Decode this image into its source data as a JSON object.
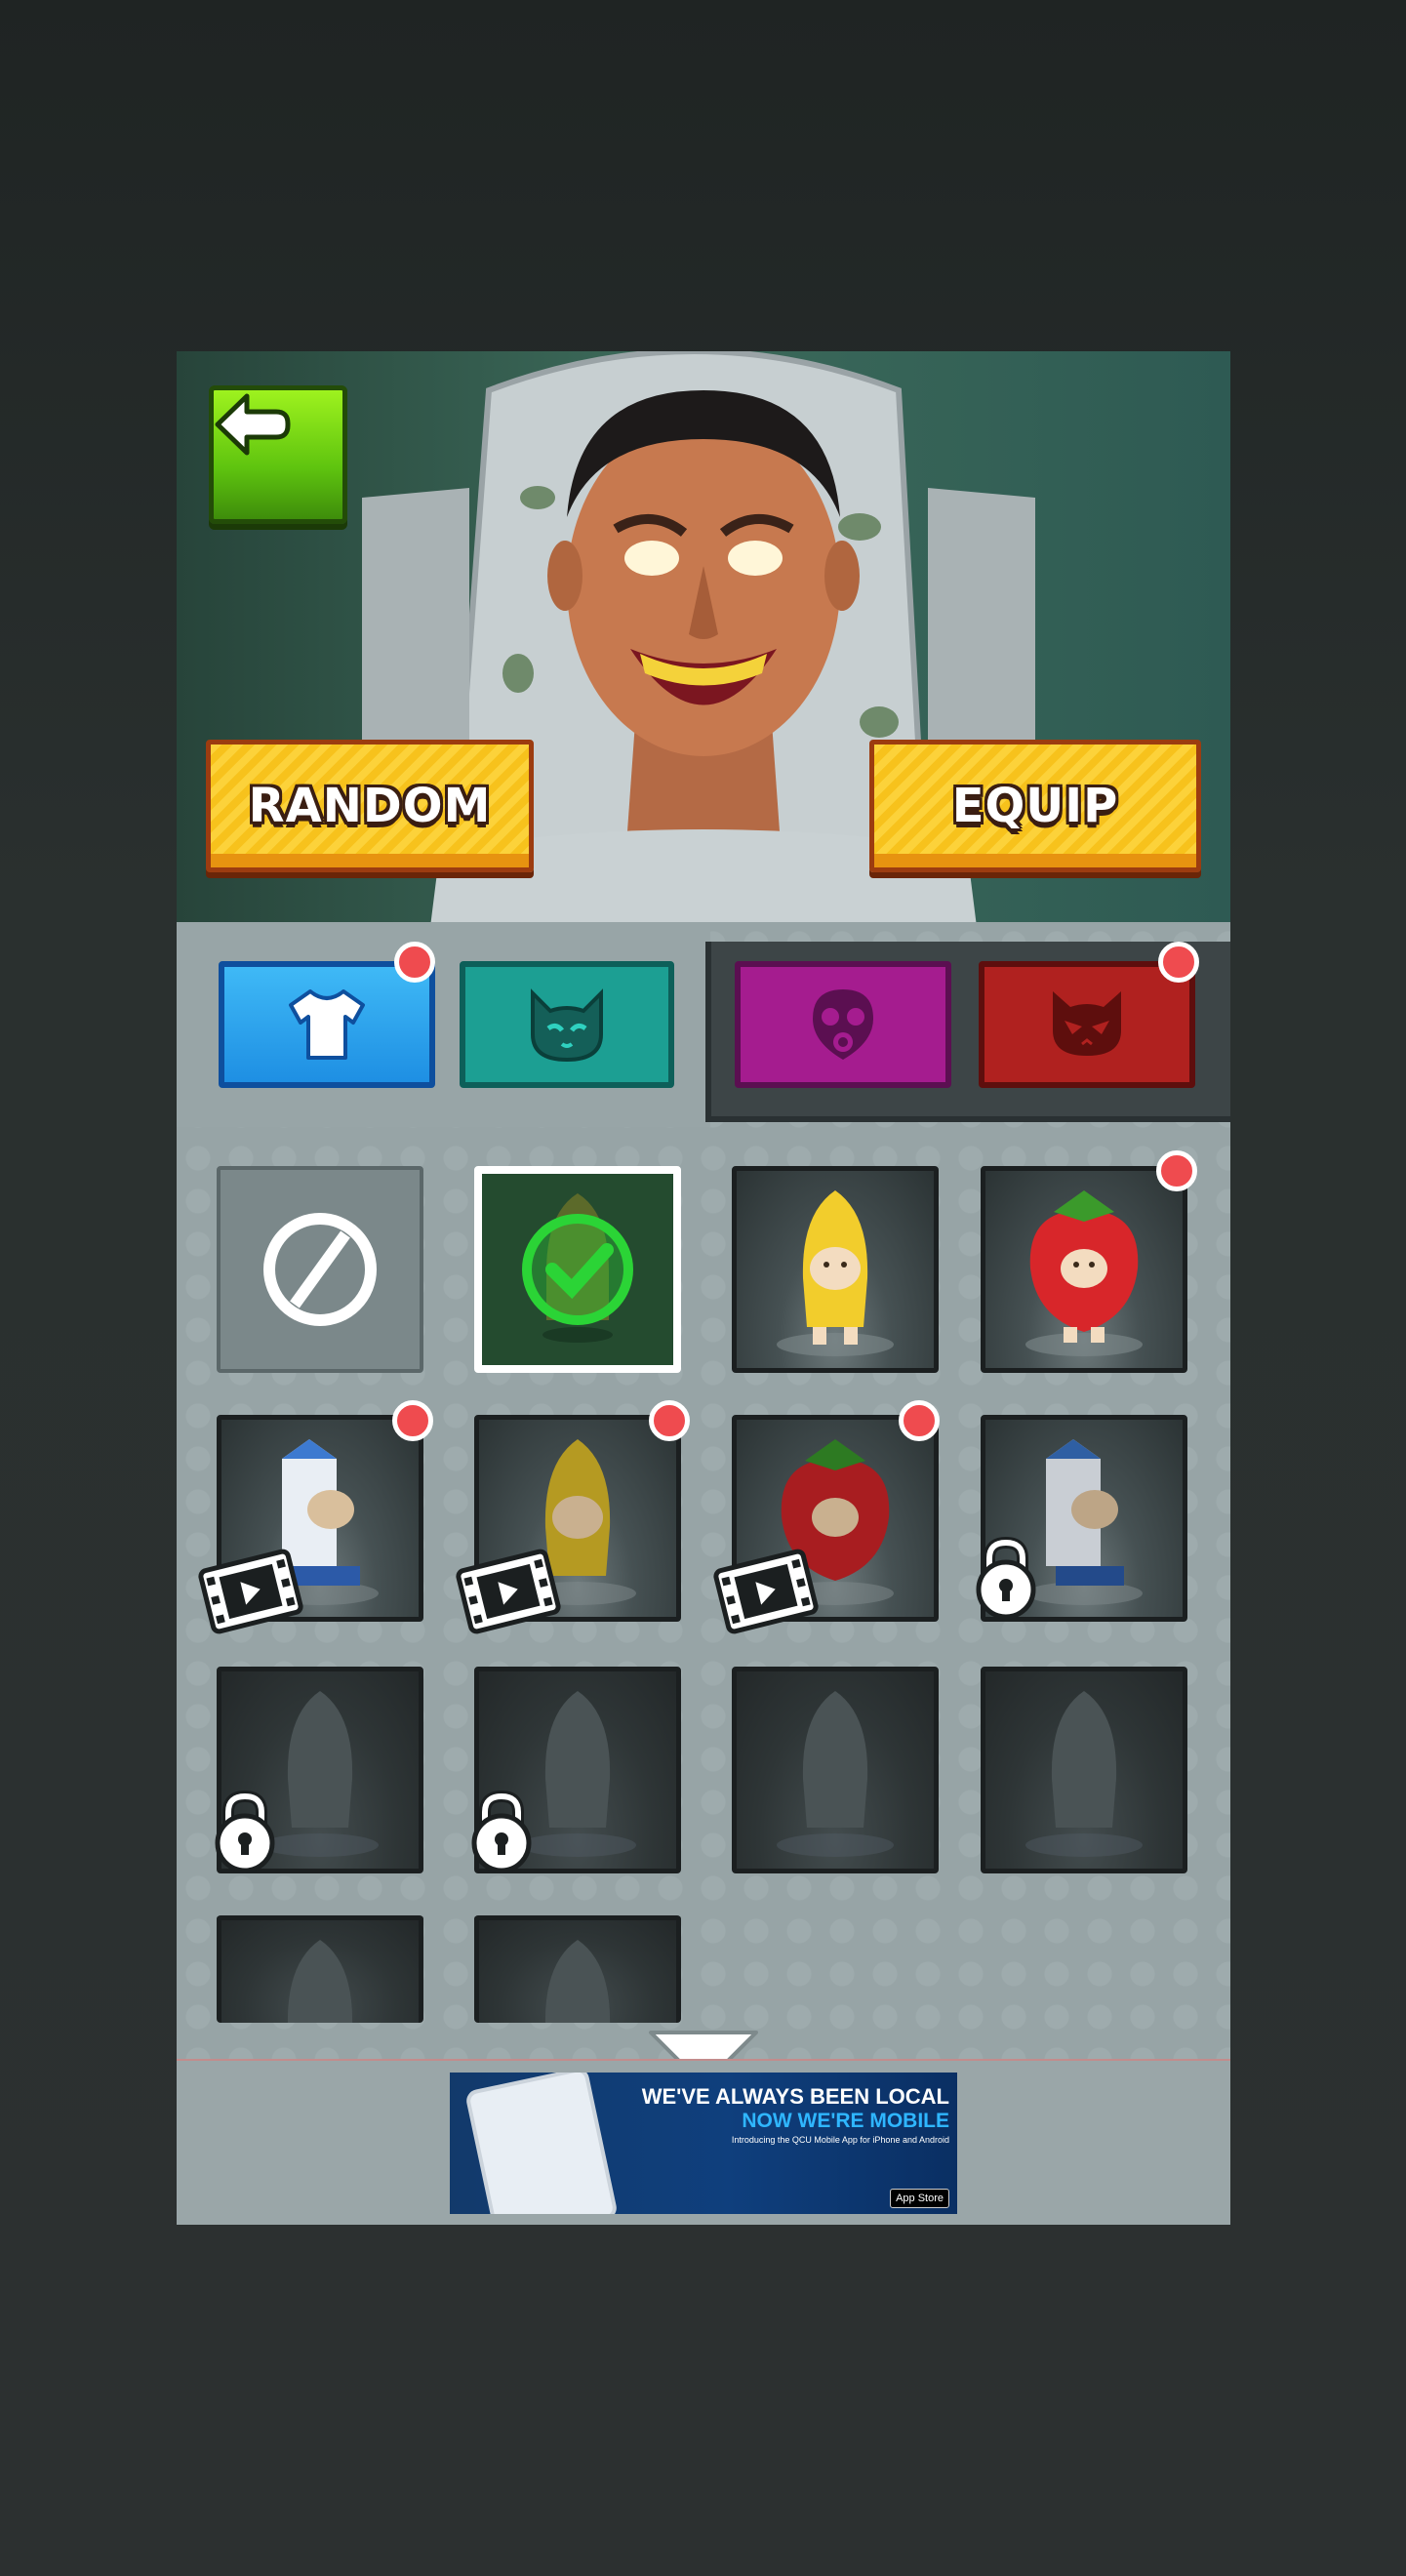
{
  "buttons": {
    "random_label": "RANDOM",
    "equip_label": "EQUIP"
  },
  "tabs": [
    {
      "name": "outfit-tab",
      "icon": "tshirt-icon",
      "color": "#1e8fe3",
      "has_notification": true
    },
    {
      "name": "cat-tab",
      "icon": "cat-face-icon",
      "color": "#1c9f93",
      "has_notification": false
    },
    {
      "name": "mask-tab",
      "icon": "gas-mask-icon",
      "color": "#a51c8f",
      "has_notification": false
    },
    {
      "name": "skull-tab",
      "icon": "cat-skull-icon",
      "color": "#b0211f",
      "has_notification": true
    }
  ],
  "grid": [
    {
      "item": "none",
      "state": "none"
    },
    {
      "item": "banana-cat-dark",
      "state": "equipped"
    },
    {
      "item": "banana-cat",
      "state": "owned"
    },
    {
      "item": "strawberry-cat",
      "state": "owned",
      "notification": true
    },
    {
      "item": "milk-carton-cat",
      "state": "watch-ad",
      "notification": true
    },
    {
      "item": "banana-cat",
      "state": "watch-ad",
      "notification": true
    },
    {
      "item": "strawberry-cat",
      "state": "watch-ad",
      "notification": true
    },
    {
      "item": "milk-carton-cat",
      "state": "locked"
    },
    {
      "item": "unknown",
      "state": "locked"
    },
    {
      "item": "unknown",
      "state": "locked"
    },
    {
      "item": "unknown",
      "state": "hidden"
    },
    {
      "item": "unknown",
      "state": "hidden"
    },
    {
      "item": "unknown",
      "state": "hidden"
    },
    {
      "item": "unknown",
      "state": "hidden"
    }
  ],
  "ad": {
    "line1": "WE'VE ALWAYS BEEN LOCAL",
    "line2": "NOW WE'RE MOBILE",
    "line3": "Introducing the QCU Mobile App for iPhone and Android",
    "store_label": "App Store"
  },
  "colors": {
    "notification": "#ef4b4f",
    "button_yellow": "#f7c21c",
    "back_green": "#5fc40f",
    "panel": "#97a4a6"
  }
}
